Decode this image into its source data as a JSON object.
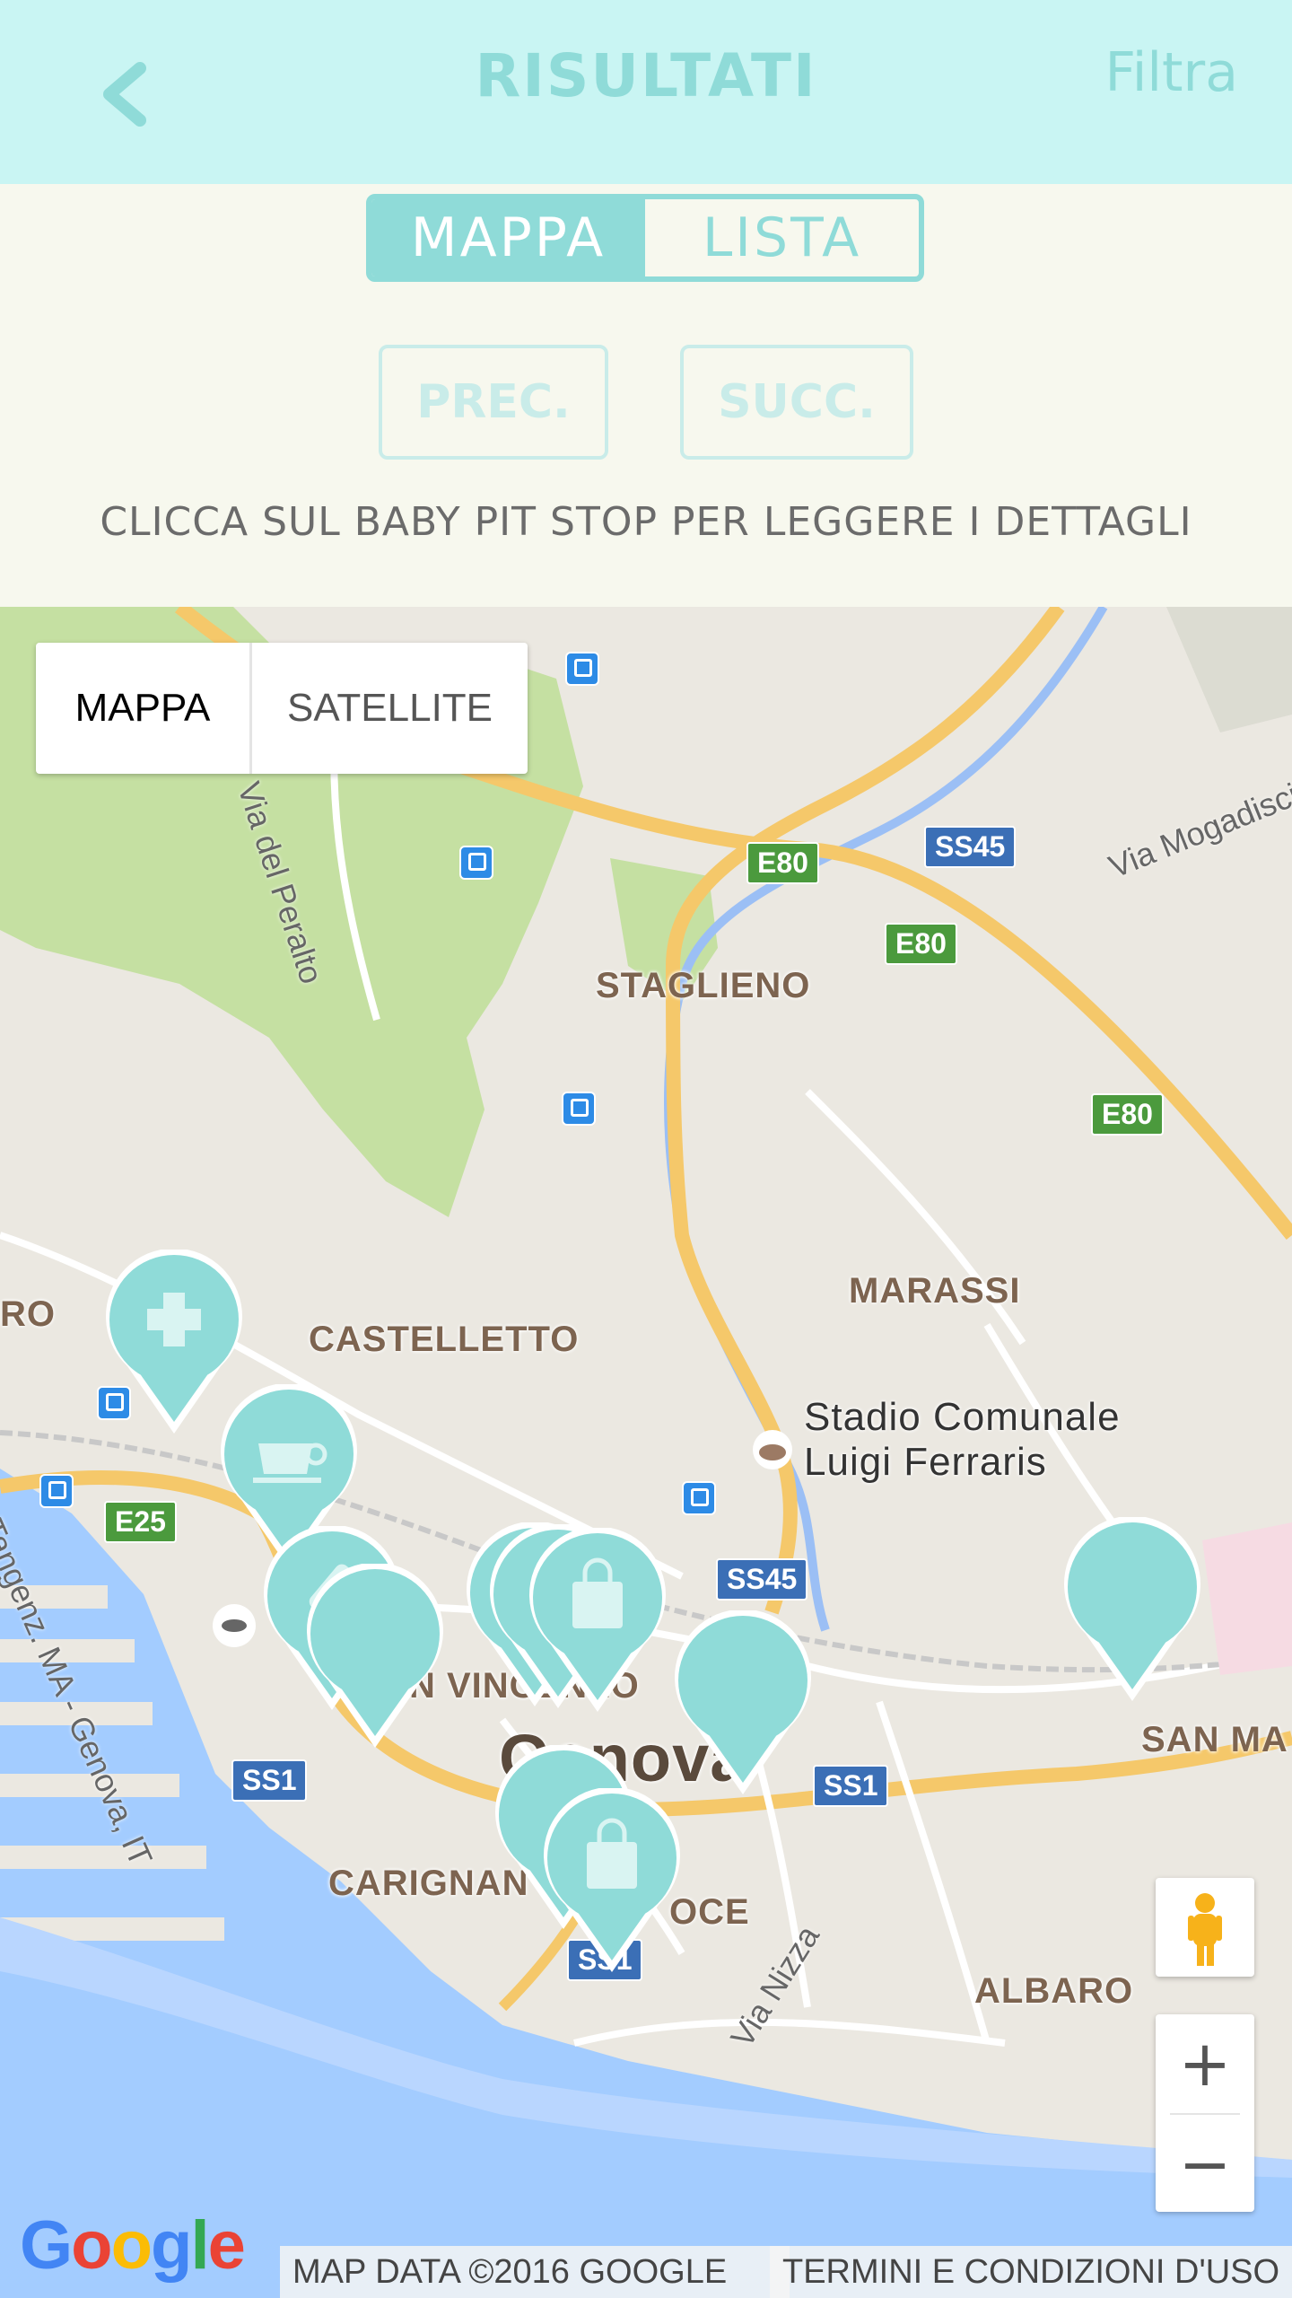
{
  "header": {
    "title": "RISULTATI",
    "filter_label": "Filtra"
  },
  "view_toggle": {
    "map_label": "MAPPA",
    "list_label": "LISTA",
    "selected": "MAPPA"
  },
  "pager": {
    "prev_label": "PREC.",
    "next_label": "SUCC."
  },
  "instruction": "CLICCA SUL BABY PIT STOP PER LEGGERE I DETTAGLI",
  "map": {
    "type_control": {
      "map_label": "MAPPA",
      "satellite_label": "SATELLITE"
    },
    "places": {
      "staglieno": "STAGLIENO",
      "marassi": "MARASSI",
      "castelletto": "CASTELLETTO",
      "stadio_line1": "Stadio Comunale",
      "stadio_line2": "Luigi Ferraris",
      "genova": "Genova",
      "carignano": "CARIGNAN",
      "foce": "OCE",
      "albaro": "ALBARO",
      "san_martino": "SAN MA",
      "vincenzo": "N VINCENZO",
      "oro": "RO"
    },
    "streets": {
      "via_del_peralto": "Via del Peralto",
      "via_mogadiscio": "Via Mogadiscio",
      "via_nizza": "Via Nizza",
      "tangenziale": "Tangenz. MA - Genova, IT"
    },
    "road_shields": [
      "E80",
      "E80",
      "E80",
      "SS45",
      "SS45",
      "E25",
      "SS1",
      "SS1",
      "SS1"
    ],
    "pins": [
      {
        "icon": "medical-cross-icon"
      },
      {
        "icon": "coffee-cup-icon"
      },
      {
        "icon": "bottle-icon"
      },
      {
        "icon": "none"
      },
      {
        "icon": "shopping-bag-icon"
      },
      {
        "icon": "none"
      },
      {
        "icon": "none"
      },
      {
        "icon": "none"
      },
      {
        "icon": "shopping-bag-icon"
      }
    ],
    "attribution": "MAP DATA ©2016 GOOGLE",
    "terms": "TERMINI E CONDIZIONI D'USO",
    "logo": "Google",
    "zoom_in": "+",
    "zoom_out": "−"
  },
  "colors": {
    "accent": "#8fdbd8",
    "header_bg": "#c9f5f3",
    "page_bg": "#f7f8ee",
    "water": "#a3ccff",
    "park": "#c5e0a2"
  }
}
